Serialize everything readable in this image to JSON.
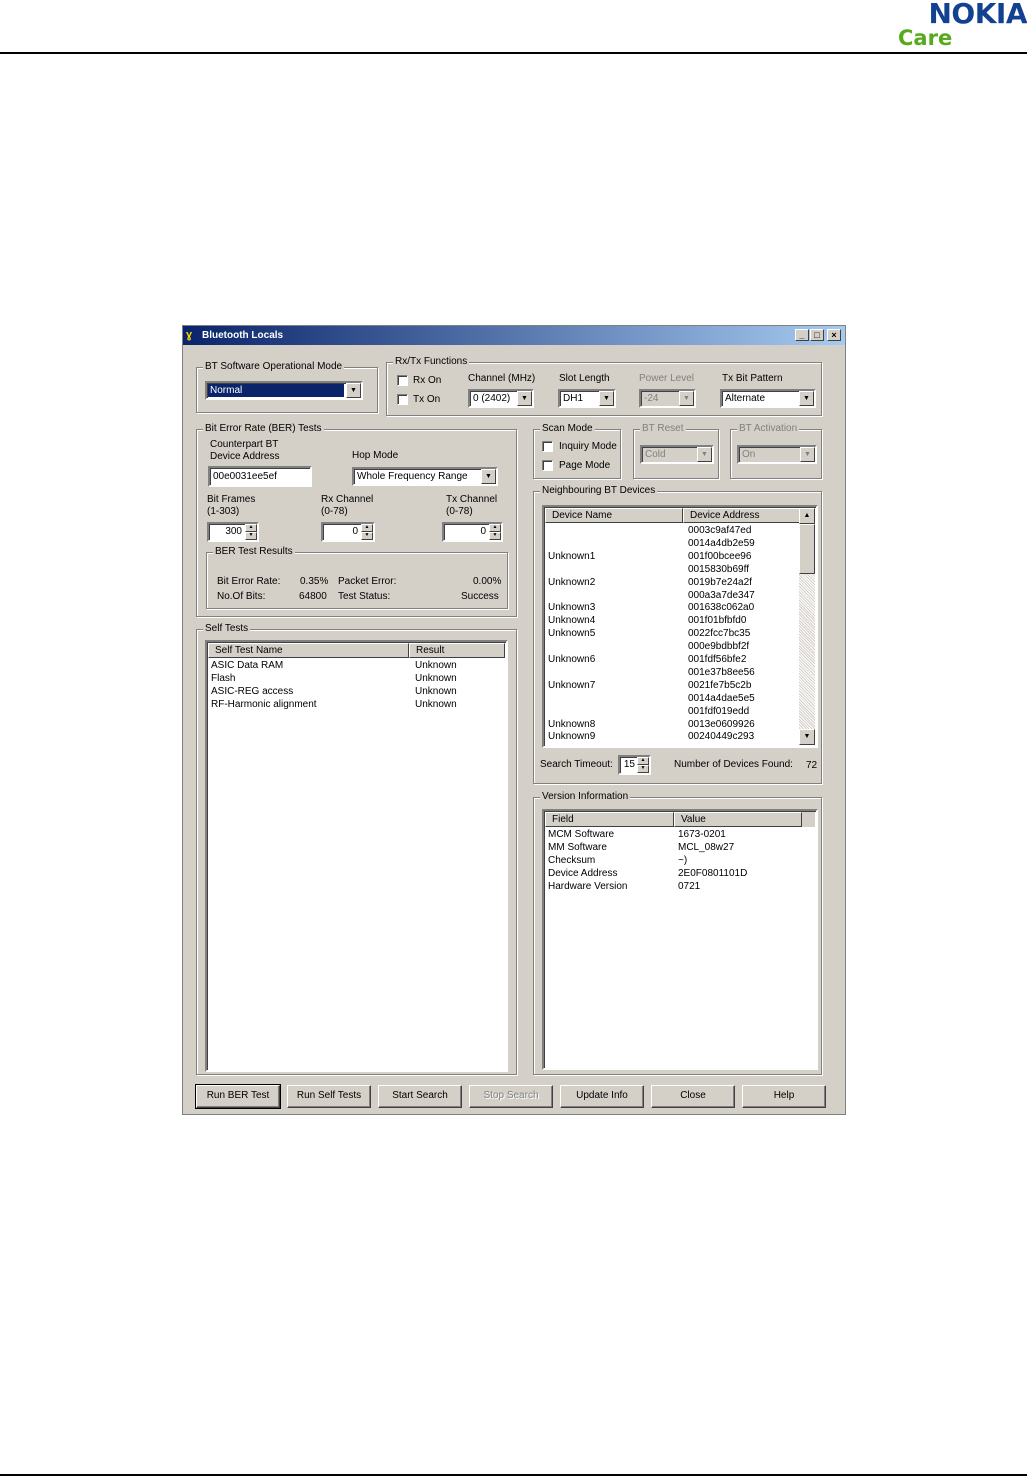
{
  "page": {
    "brand_top": "NOKIA",
    "brand_bottom": "Care"
  },
  "window": {
    "title": "Bluetooth Locals",
    "icon": "app-icon",
    "controls": {
      "minimize": "_",
      "maximize": "□",
      "close": "×"
    }
  },
  "sw_mode": {
    "title": "BT Software Operational Mode",
    "selected": "Normal"
  },
  "rxtx": {
    "title": "Rx/Tx Functions",
    "rx_on": "Rx On",
    "tx_on": "Tx On",
    "channel_label": "Channel (MHz)",
    "channel_value": "0  (2402)",
    "slot_label": "Slot Length",
    "slot_value": "DH1",
    "power_label": "Power Level",
    "power_value": "-24",
    "txbit_label": "Tx Bit Pattern",
    "txbit_value": "Alternate"
  },
  "ber": {
    "title": "Bit Error Rate (BER) Tests",
    "counterpart_label_1": "Counterpart BT",
    "counterpart_label_2": "Device Address",
    "counterpart_value": "00e0031ee5ef",
    "hop_label": "Hop Mode",
    "hop_value": "Whole Frequency Range",
    "bit_frames_label": "Bit Frames",
    "bit_frames_range": "(1-303)",
    "bit_frames_value": "300",
    "rx_channel_label": "Rx Channel",
    "rx_channel_range": "(0-78)",
    "rx_channel_value": "0",
    "tx_channel_label": "Tx Channel",
    "tx_channel_range": "(0-78)",
    "tx_channel_value": "0",
    "results": {
      "title": "BER Test Results",
      "bit_error_rate_label": "Bit Error Rate:",
      "bit_error_rate_value": "0.35%",
      "packet_error_label": "Packet Error:",
      "packet_error_value": "0.00%",
      "no_of_bits_label": "No.Of Bits:",
      "no_of_bits_value": "64800",
      "test_status_label": "Test Status:",
      "test_status_value": "Success"
    }
  },
  "scan_mode": {
    "title": "Scan Mode",
    "inquiry": "Inquiry Mode",
    "page": "Page Mode"
  },
  "bt_reset": {
    "title": "BT Reset",
    "value": "Cold"
  },
  "bt_activation": {
    "title": "BT Activation",
    "value": "On"
  },
  "neighbours": {
    "title": "Neighbouring BT Devices",
    "columns": [
      "Device Name",
      "Device Address"
    ],
    "rows": [
      {
        "name": "",
        "address": "0003c9af47ed"
      },
      {
        "name": "",
        "address": "0014a4db2e59"
      },
      {
        "name": "Unknown1",
        "address": "001f00bcee96"
      },
      {
        "name": "",
        "address": "0015830b69ff"
      },
      {
        "name": "Unknown2",
        "address": "0019b7e24a2f"
      },
      {
        "name": "",
        "address": "000a3a7de347"
      },
      {
        "name": "Unknown3",
        "address": "001638c062a0"
      },
      {
        "name": "Unknown4",
        "address": "001f01bfbfd0"
      },
      {
        "name": "Unknown5",
        "address": "0022fcc7bc35"
      },
      {
        "name": "",
        "address": "000e9bdbbf2f"
      },
      {
        "name": "Unknown6",
        "address": "001fdf56bfe2"
      },
      {
        "name": "",
        "address": "001e37b8ee56"
      },
      {
        "name": "Unknown7",
        "address": "0021fe7b5c2b"
      },
      {
        "name": "",
        "address": "0014a4dae5e5"
      },
      {
        "name": "",
        "address": "001fdf019edd"
      },
      {
        "name": "Unknown8",
        "address": "0013e0609926"
      },
      {
        "name": "Unknown9",
        "address": "00240449c293"
      }
    ],
    "search_timeout_label": "Search Timeout:",
    "search_timeout_value": "15",
    "devices_found_label": "Number of Devices Found:",
    "devices_found_value": "72"
  },
  "self_tests": {
    "title": "Self Tests",
    "columns": [
      "Self Test Name",
      "Result"
    ],
    "rows": [
      {
        "name": "ASIC Data RAM",
        "result": "Unknown"
      },
      {
        "name": "Flash",
        "result": "Unknown"
      },
      {
        "name": "ASIC-REG access",
        "result": "Unknown"
      },
      {
        "name": "RF-Harmonic alignment",
        "result": "Unknown"
      }
    ]
  },
  "version_info": {
    "title": "Version Information",
    "columns": [
      "Field",
      "Value"
    ],
    "rows": [
      {
        "field": "MCM Software",
        "value": "1673-0201"
      },
      {
        "field": "MM Software",
        "value": "MCL_08w27"
      },
      {
        "field": "Checksum",
        "value": "~)"
      },
      {
        "field": "Device Address",
        "value": "2E0F0801101D"
      },
      {
        "field": "Hardware Version",
        "value": "0721"
      }
    ]
  },
  "buttons": {
    "run_ber": "Run BER Test",
    "run_self": "Run Self Tests",
    "start_search": "Start Search",
    "stop_search": "Stop Search",
    "update_info": "Update Info",
    "close": "Close",
    "help": "Help"
  },
  "icons": {
    "dropdown": "▼",
    "scroll_up": "▲",
    "scroll_down": "▼",
    "spin_up": "▲",
    "spin_down": "▼"
  }
}
